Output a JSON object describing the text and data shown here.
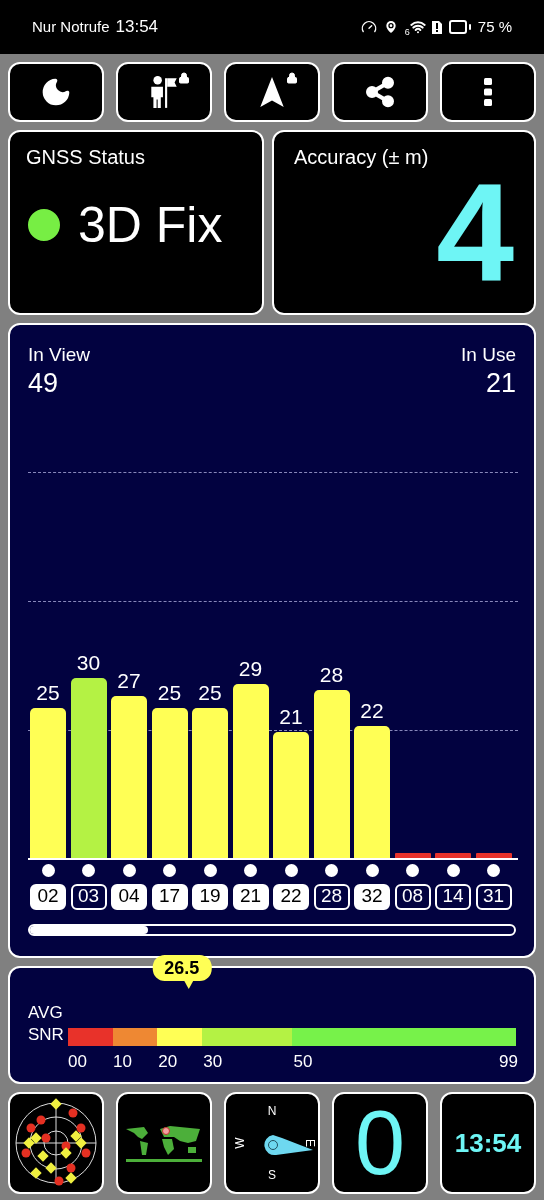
{
  "status_bar": {
    "carrier": "Nur Notrufe",
    "time": "13:54",
    "wifi_badge": "6",
    "battery": "75 %"
  },
  "toolbar": [
    {
      "kind": "night",
      "locked": false
    },
    {
      "kind": "waypoint",
      "locked": true
    },
    {
      "kind": "navigate",
      "locked": true
    },
    {
      "kind": "share",
      "locked": false
    },
    {
      "kind": "menu",
      "locked": false
    }
  ],
  "gnss_status": {
    "title": "GNSS Status",
    "fix": "3D Fix"
  },
  "accuracy": {
    "title": "Accuracy (± m)",
    "value": "4"
  },
  "satellites": {
    "in_view_label": "In View",
    "in_view": "49",
    "in_use_label": "In Use",
    "in_use": "21",
    "list": [
      {
        "prn": "02",
        "snr": "25",
        "color": "#ffff55",
        "used": true
      },
      {
        "prn": "03",
        "snr": "30",
        "color": "#b4f244",
        "used": false
      },
      {
        "prn": "04",
        "snr": "27",
        "color": "#ffff55",
        "used": true
      },
      {
        "prn": "17",
        "snr": "25",
        "color": "#ffff55",
        "used": true
      },
      {
        "prn": "19",
        "snr": "25",
        "color": "#ffff55",
        "used": true
      },
      {
        "prn": "21",
        "snr": "29",
        "color": "#ffff55",
        "used": true
      },
      {
        "prn": "22",
        "snr": "21",
        "color": "#ffff55",
        "used": true
      },
      {
        "prn": "28",
        "snr": "28",
        "color": "#ffff55",
        "used": false
      },
      {
        "prn": "32",
        "snr": "22",
        "color": "#ffff55",
        "used": true
      },
      {
        "prn": "08",
        "color": "#e8322a",
        "used": false
      },
      {
        "prn": "14",
        "color": "#e8322a",
        "used": false
      },
      {
        "prn": "31",
        "color": "#e8322a",
        "used": false
      }
    ]
  },
  "snr": {
    "label_1": "AVG",
    "label_2": "SNR",
    "average": "26.5",
    "level": 0.265,
    "scale": [
      {
        "label": "00",
        "color": "#e8322a"
      },
      {
        "label": "10",
        "color": "#ee8833"
      },
      {
        "label": "20",
        "color": "#ffff55"
      },
      {
        "label": "30",
        "color": "#b4f244"
      },
      {
        "label": "50",
        "color": "#77f24a"
      }
    ],
    "end_label": "99"
  },
  "tiles": {
    "compass": {
      "north": "N",
      "west": "W",
      "east": "E",
      "south": "S"
    },
    "speed": "0",
    "clock": "13:54"
  }
}
